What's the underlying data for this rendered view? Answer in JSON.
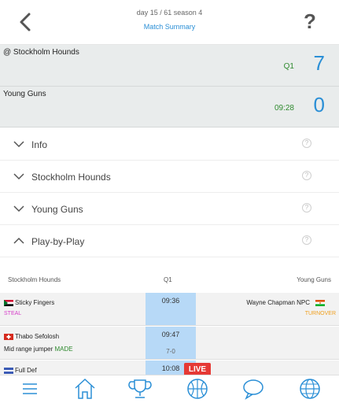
{
  "header": {
    "day_text": "day 15 / 61 season 4",
    "summary_link": "Match Summary",
    "help_label": "?"
  },
  "teams": [
    {
      "name": "@ Stockholm Hounds",
      "period": "Q1",
      "score": "7"
    },
    {
      "name": "Young Guns",
      "period": "09:28",
      "score": "0"
    }
  ],
  "sections": [
    {
      "label": "Info",
      "expanded": false
    },
    {
      "label": "Stockholm Hounds",
      "expanded": false
    },
    {
      "label": "Young Guns",
      "expanded": false
    },
    {
      "label": "Play-by-Play",
      "expanded": true
    }
  ],
  "section_help": "?",
  "pbp": {
    "home_team": "Stockholm Hounds",
    "quarter": "Q1",
    "away_team": "Young Guns",
    "rows": [
      {
        "time": "09:36",
        "score": "",
        "home_player": "Sticky Fingers",
        "home_action": "STEAL",
        "away_player": "Wayne Chapman NPC",
        "away_action": "TURNOVER"
      },
      {
        "time": "09:47",
        "score": "7-0",
        "home_player": "Thabo Sefolosh",
        "home_action_prefix": "Mid range jumper",
        "home_action": "MADE",
        "away_player": "",
        "away_action": ""
      },
      {
        "time": "10:08",
        "score": "",
        "home_player": "Full Def",
        "home_action": "",
        "away_player": "",
        "away_action": ""
      }
    ]
  },
  "live_badge": "LIVE",
  "colors": {
    "accent_blue": "#2b8fd6",
    "period_green": "#2f8a2f",
    "steal_magenta": "#d63cc9",
    "turnover_orange": "#f0a020",
    "made_green": "#2f8a2f",
    "time_highlight": "#b7d9f7",
    "live_red": "#e53935"
  },
  "nav_icons": [
    "menu-icon",
    "home-icon",
    "trophy-icon",
    "basketball-icon",
    "chat-icon",
    "globe-icon"
  ]
}
